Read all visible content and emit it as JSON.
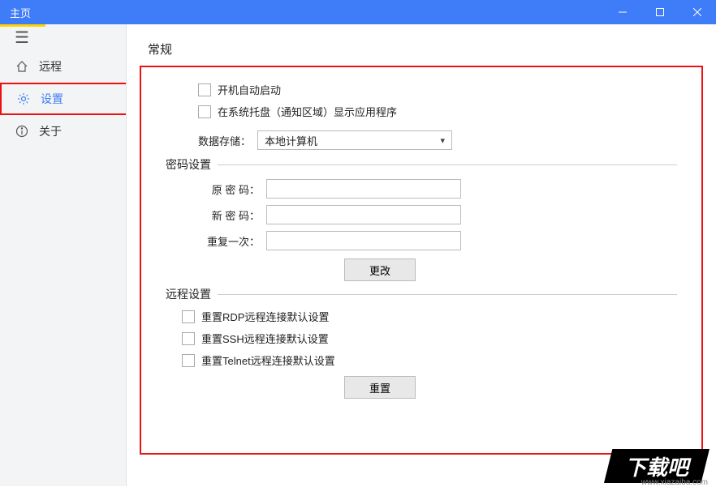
{
  "title": "主页",
  "sidebar": {
    "items": [
      {
        "label": "远程"
      },
      {
        "label": "设置"
      },
      {
        "label": "关于"
      }
    ]
  },
  "general": {
    "heading": "常规",
    "autostart": "开机自动启动",
    "tray": "在系统托盘（通知区域）显示应用程序",
    "storage_label": "数据存储：",
    "storage_value": "本地计算机"
  },
  "password": {
    "heading": "密码设置",
    "old_label": "原 密 码：",
    "new_label": "新 密 码：",
    "repeat_label": "重复一次：",
    "button": "更改"
  },
  "remote": {
    "heading": "远程设置",
    "rdp": "重置RDP远程连接默认设置",
    "ssh": "重置SSH远程连接默认设置",
    "telnet": "重置Telnet远程连接默认设置",
    "button": "重置"
  },
  "watermark": {
    "logo": "下载吧",
    "url": "www.xiazaiba.com"
  }
}
